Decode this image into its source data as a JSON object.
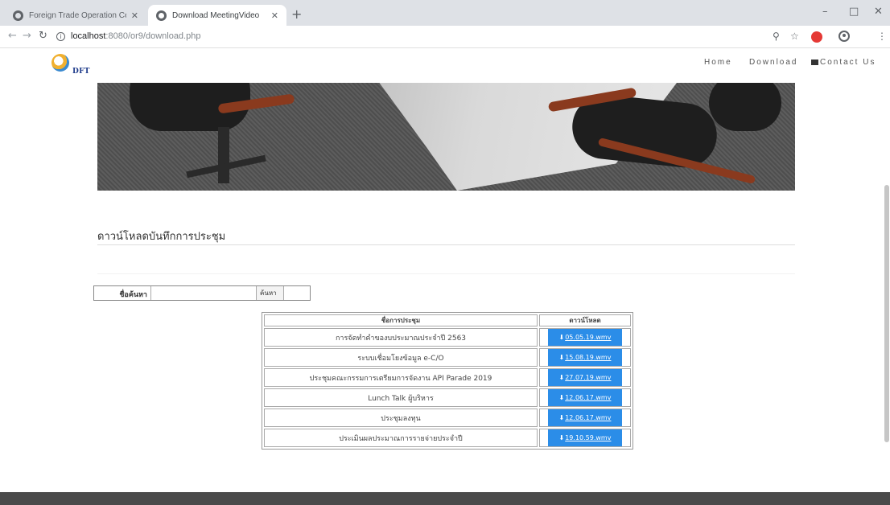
{
  "browser": {
    "tabs": [
      {
        "title": "Foreign Trade Operation Center",
        "active": false
      },
      {
        "title": "Download MeetingVideo",
        "active": true
      }
    ],
    "new_tab": "+",
    "url_host": "localhost",
    "url_path": ":8080/or9/download.php",
    "window_controls": {
      "minimize": "–",
      "maximize": "□",
      "close": "✕"
    }
  },
  "site": {
    "logo_text": "DFT",
    "nav": {
      "home": "Home",
      "download": "Download",
      "contact": "Contact Us"
    }
  },
  "main": {
    "section_title": "ดาวน์โหลดบันทึกการประชุม",
    "search": {
      "label": "ชื่อค้นหา",
      "placeholder": "",
      "button": "ค้นหา"
    },
    "table": {
      "headers": [
        "ชื่อการประชุม",
        "ดาวน์โหลด"
      ],
      "rows": [
        {
          "name": "การจัดทำคำของบประมาณประจำปี 2563",
          "file": "05.05.19.wmv"
        },
        {
          "name": "ระบบเชื่อมโยงข้อมูล e-C/O",
          "file": "15.08.19.wmv"
        },
        {
          "name": "ประชุมคณะกรรมการเตรียมการจัดงาน API Parade 2019",
          "file": "27.07.19.wmv"
        },
        {
          "name": "Lunch Talk ผู้บริหาร",
          "file": "12.06.17.wmv"
        },
        {
          "name": "ประชุมลงทุน",
          "file": "12.06.17.wmv"
        },
        {
          "name": "ประเมินผลประมาณการรายจ่ายประจำปี",
          "file": "19.10.59.wmv"
        }
      ]
    }
  },
  "colors": {
    "download_button": "#2b8de8",
    "footer": "#4a4a4a"
  }
}
